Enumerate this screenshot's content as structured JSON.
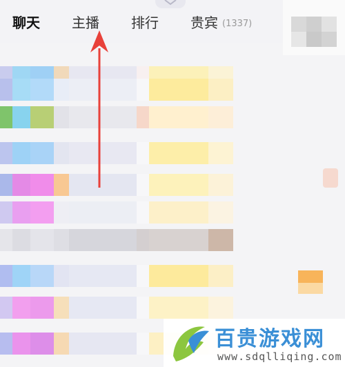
{
  "tabs": [
    {
      "label": "聊天",
      "active": true
    },
    {
      "label": "主播",
      "active": false
    },
    {
      "label": "排行",
      "active": false
    },
    {
      "label": "贵宾",
      "active": false,
      "count": "(1337)"
    }
  ],
  "watermark": {
    "title": "百贵游戏网",
    "url": "www.sdqlliqing.com"
  },
  "colors": {
    "accent_arrow": "#e8413a",
    "brand_blue": "#3a8fd6",
    "brand_green": "#8cc63f"
  }
}
